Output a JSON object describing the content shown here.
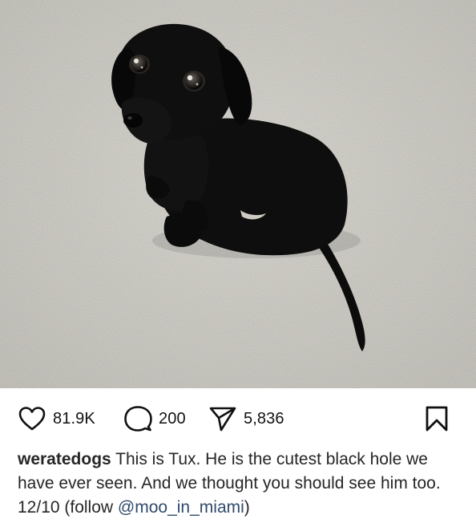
{
  "post": {
    "image": {
      "subject": "black dachshund puppy on carpet",
      "icon": "photo"
    },
    "actions": {
      "likes": "81.9K",
      "comments": "200",
      "shares": "5,836"
    },
    "caption": {
      "username": "weratedogs",
      "text": " This is Tux. He is the cutest black hole we have ever seen. And we thought you should see him too. 12/10 (follow ",
      "mention": "@moo_in_miami",
      "end": ")"
    }
  },
  "colors": {
    "text": "#262626",
    "mention": "#2f4a6b",
    "background": "#ffffff"
  }
}
